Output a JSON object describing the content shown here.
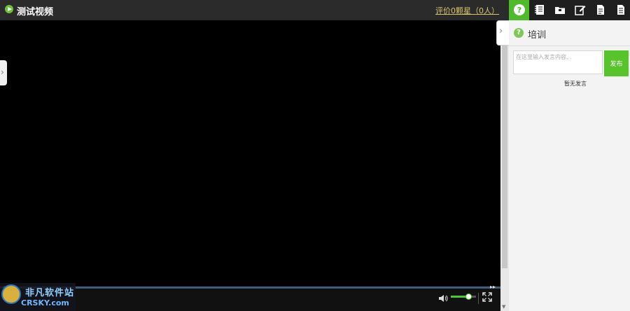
{
  "header": {
    "title": "测试视频",
    "rating_link": "评价0颗星（0人）"
  },
  "player": {
    "volume_level": 0.7
  },
  "watermark": {
    "name": "非凡软件站",
    "domain": "CRSKY.com"
  },
  "toolbar": {
    "tools": [
      {
        "icon": "help-icon",
        "active": true
      },
      {
        "icon": "notebook-icon",
        "active": false
      },
      {
        "icon": "folder-icon",
        "active": false
      },
      {
        "icon": "edit-icon",
        "active": false
      },
      {
        "icon": "document-icon",
        "active": false
      },
      {
        "icon": "document-lines-icon",
        "active": false
      }
    ]
  },
  "panel": {
    "title": "培训",
    "comment_placeholder": "在这里输入发言内容...",
    "publish_label": "发布",
    "empty_message": "暂无发言"
  },
  "colors": {
    "accent": "#57c42c",
    "rating_link": "#d9c36a",
    "panel_bg": "#f3f3f3"
  }
}
